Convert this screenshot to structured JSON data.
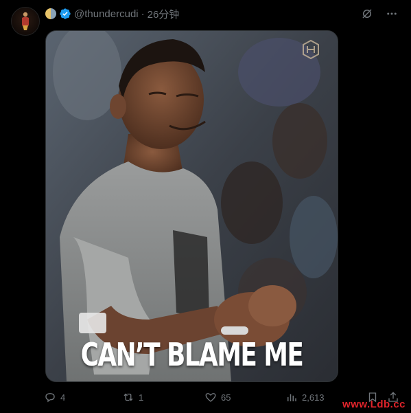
{
  "post": {
    "handle": "@thundercudi",
    "separator": "·",
    "time": "26分钟",
    "image_caption": "CAN’T BLAME ME"
  },
  "actions": {
    "replies": "4",
    "reposts": "1",
    "likes": "65",
    "views": "2,613"
  },
  "watermark": {
    "text": "www.Ldb.cc"
  },
  "icons": {
    "grok": "grok-icon",
    "more": "more-icon",
    "reply": "reply-icon",
    "repost": "repost-icon",
    "like": "like-icon",
    "views": "views-icon",
    "bookmark": "bookmark-icon",
    "share": "share-icon",
    "verified": "verified-badge-icon"
  },
  "colors": {
    "background": "#000000",
    "muted_text": "#71767b",
    "verified_blue": "#1d9bf0",
    "watermark_red": "#e0242b"
  }
}
